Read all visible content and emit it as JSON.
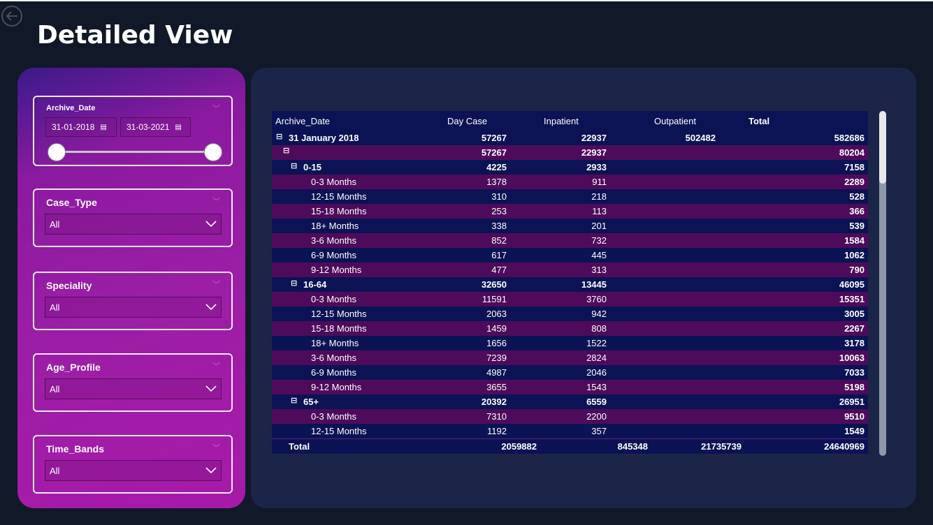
{
  "page": {
    "title": "Detailed View"
  },
  "filters": {
    "archive_date": {
      "title": "Archive_Date",
      "start": "31-01-2018",
      "end": "31-03-2021"
    },
    "case_type": {
      "title": "Case_Type",
      "value": "All"
    },
    "speciality": {
      "title": "Speciality",
      "value": "All"
    },
    "age_profile": {
      "title": "Age_Profile",
      "value": "All"
    },
    "time_bands": {
      "title": "Time_Bands",
      "value": "All"
    }
  },
  "matrix": {
    "headers": [
      "Archive_Date",
      "Day Case",
      "Inpatient",
      "Outpatient",
      "Total"
    ],
    "rows": [
      {
        "label": "31 January 2018",
        "day": "57267",
        "inp": "22937",
        "out": "502482",
        "total": "582686",
        "level": 0,
        "toggle": "⊟"
      },
      {
        "label": "",
        "day": "57267",
        "inp": "22937",
        "out": "",
        "total": "80204",
        "level": 1,
        "toggle": "⊟"
      },
      {
        "label": "0-15",
        "day": "4225",
        "inp": "2933",
        "out": "",
        "total": "7158",
        "level": 2,
        "toggle": "⊟"
      },
      {
        "label": "0-3 Months",
        "day": "1378",
        "inp": "911",
        "out": "",
        "total": "2289",
        "level": 3
      },
      {
        "label": "12-15 Months",
        "day": "310",
        "inp": "218",
        "out": "",
        "total": "528",
        "level": 3
      },
      {
        "label": "15-18 Months",
        "day": "253",
        "inp": "113",
        "out": "",
        "total": "366",
        "level": 3
      },
      {
        "label": "18+ Months",
        "day": "338",
        "inp": "201",
        "out": "",
        "total": "539",
        "level": 3
      },
      {
        "label": "3-6 Months",
        "day": "852",
        "inp": "732",
        "out": "",
        "total": "1584",
        "level": 3
      },
      {
        "label": "6-9 Months",
        "day": "617",
        "inp": "445",
        "out": "",
        "total": "1062",
        "level": 3
      },
      {
        "label": "9-12 Months",
        "day": "477",
        "inp": "313",
        "out": "",
        "total": "790",
        "level": 3
      },
      {
        "label": "16-64",
        "day": "32650",
        "inp": "13445",
        "out": "",
        "total": "46095",
        "level": 2,
        "toggle": "⊟"
      },
      {
        "label": "0-3 Months",
        "day": "11591",
        "inp": "3760",
        "out": "",
        "total": "15351",
        "level": 3
      },
      {
        "label": "12-15 Months",
        "day": "2063",
        "inp": "942",
        "out": "",
        "total": "3005",
        "level": 3
      },
      {
        "label": "15-18 Months",
        "day": "1459",
        "inp": "808",
        "out": "",
        "total": "2267",
        "level": 3
      },
      {
        "label": "18+ Months",
        "day": "1656",
        "inp": "1522",
        "out": "",
        "total": "3178",
        "level": 3
      },
      {
        "label": "3-6 Months",
        "day": "7239",
        "inp": "2824",
        "out": "",
        "total": "10063",
        "level": 3
      },
      {
        "label": "6-9 Months",
        "day": "4987",
        "inp": "2046",
        "out": "",
        "total": "7033",
        "level": 3
      },
      {
        "label": "9-12 Months",
        "day": "3655",
        "inp": "1543",
        "out": "",
        "total": "5198",
        "level": 3
      },
      {
        "label": "65+",
        "day": "20392",
        "inp": "6559",
        "out": "",
        "total": "26951",
        "level": 2,
        "toggle": "⊟"
      },
      {
        "label": "0-3 Months",
        "day": "7310",
        "inp": "2200",
        "out": "",
        "total": "9510",
        "level": 3
      },
      {
        "label": "12-15 Months",
        "day": "1192",
        "inp": "357",
        "out": "",
        "total": "1549",
        "level": 3
      }
    ],
    "total": {
      "label": "Total",
      "day": "2059882",
      "inp": "845348",
      "out": "21735739",
      "total": "24640969"
    }
  }
}
